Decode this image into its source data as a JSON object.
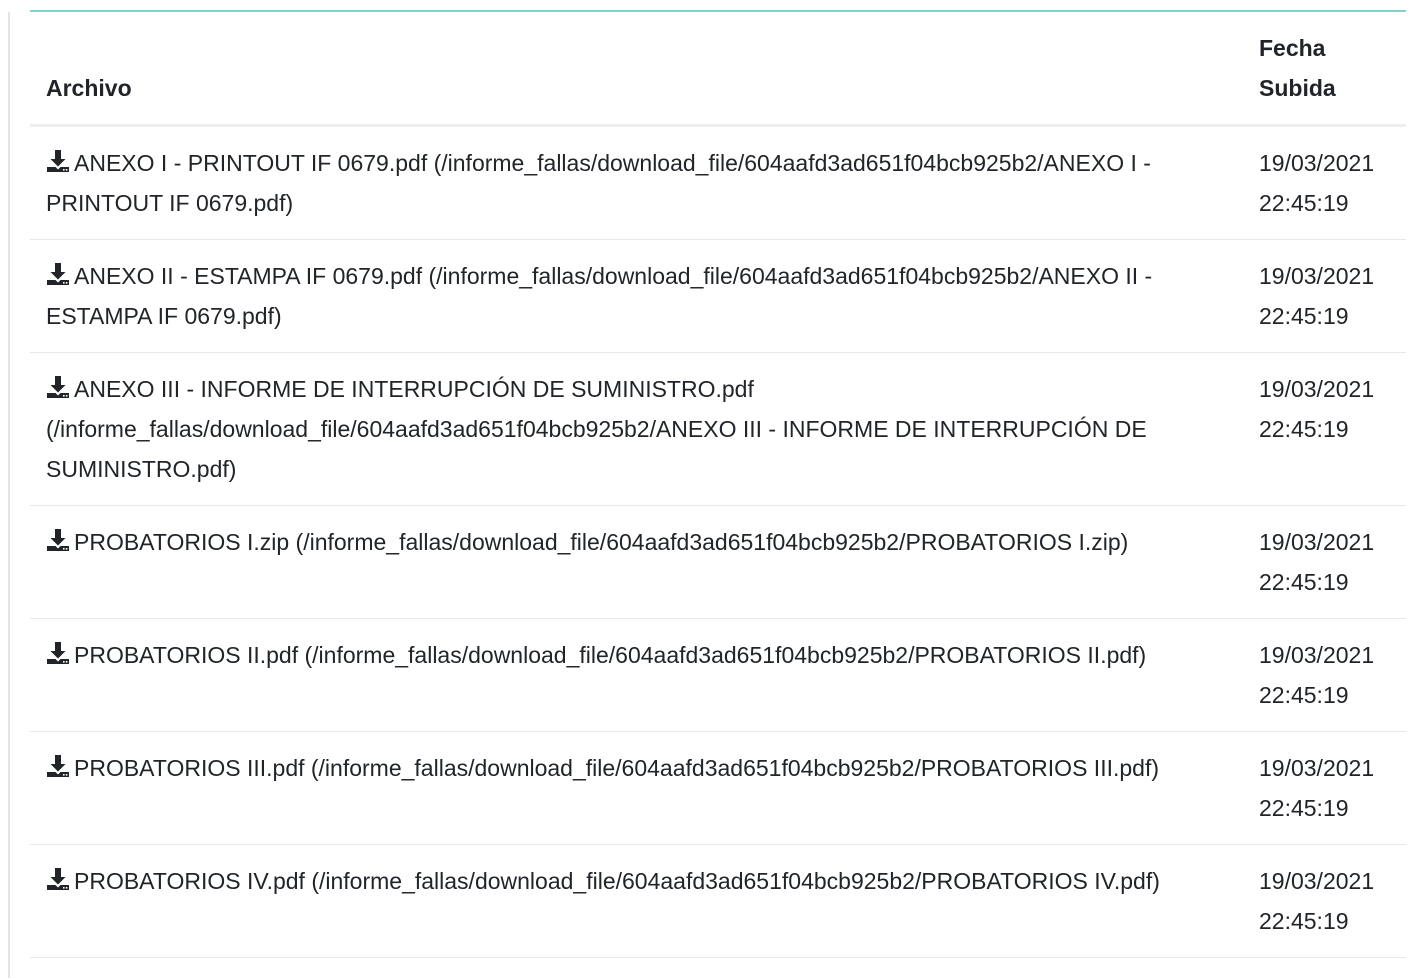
{
  "table": {
    "headers": {
      "file": "Archivo",
      "date_line1": "Fecha",
      "date_line2": "Subida"
    },
    "rows": [
      {
        "icon": "download-icon",
        "text": "ANEXO I - PRINTOUT IF 0679.pdf (/informe_fallas/download_file/604aafd3ad651f04bcb925b2/ANEXO I - PRINTOUT IF 0679.pdf)",
        "date": "19/03/2021",
        "time": "22:45:19"
      },
      {
        "icon": "download-icon",
        "text": "ANEXO II - ESTAMPA IF 0679.pdf (/informe_fallas/download_file/604aafd3ad651f04bcb925b2/ANEXO II - ESTAMPA IF 0679.pdf)",
        "date": "19/03/2021",
        "time": "22:45:19"
      },
      {
        "icon": "download-icon",
        "text": "ANEXO III - INFORME DE INTERRUPCIÓN DE SUMINISTRO.pdf (/informe_fallas/download_file/604aafd3ad651f04bcb925b2/ANEXO III - INFORME DE INTERRUPCIÓN DE SUMINISTRO.pdf)",
        "date": "19/03/2021",
        "time": "22:45:19"
      },
      {
        "icon": "download-icon",
        "text": "PROBATORIOS I.zip (/informe_fallas/download_file/604aafd3ad651f04bcb925b2/PROBATORIOS I.zip)",
        "date": "19/03/2021",
        "time": "22:45:19"
      },
      {
        "icon": "download-icon",
        "text": "PROBATORIOS II.pdf (/informe_fallas/download_file/604aafd3ad651f04bcb925b2/PROBATORIOS II.pdf)",
        "date": "19/03/2021",
        "time": "22:45:19"
      },
      {
        "icon": "download-icon",
        "text": "PROBATORIOS III.pdf (/informe_fallas/download_file/604aafd3ad651f04bcb925b2/PROBATORIOS III.pdf)",
        "date": "19/03/2021",
        "time": "22:45:19"
      },
      {
        "icon": "download-icon",
        "text": "PROBATORIOS IV.pdf (/informe_fallas/download_file/604aafd3ad651f04bcb925b2/PROBATORIOS IV.pdf)",
        "date": "19/03/2021",
        "time": "22:45:19"
      }
    ]
  },
  "colors": {
    "accent_rule": "#7ed3cf",
    "text": "#212529",
    "row_border": "#e8e8e8"
  }
}
